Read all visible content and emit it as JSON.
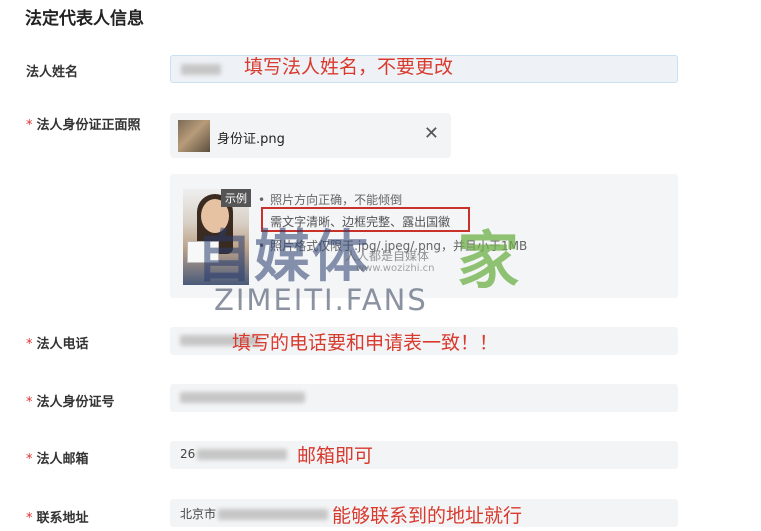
{
  "section": {
    "title": "法定代表人信息"
  },
  "fields": {
    "name": {
      "label": "法人姓名",
      "annotation": "填写法人姓名，不要更改"
    },
    "id_photo": {
      "label": "法人身份证正面照",
      "required_mark": "*",
      "file_name": "身份证.png",
      "close_icon": "close-icon"
    },
    "phone": {
      "label": "法人电话",
      "required_mark": "*",
      "annotation": "填写的电话要和申请表一致！！"
    },
    "id_number": {
      "label": "法人身份证号",
      "required_mark": "*"
    },
    "email": {
      "label": "法人邮箱",
      "required_mark": "*",
      "value_prefix": "26",
      "annotation": "邮箱即可"
    },
    "address": {
      "label": "联系地址",
      "required_mark": "*",
      "value_prefix": "北京市",
      "annotation": "能够联系到的地址就行"
    }
  },
  "example": {
    "badge": "示例",
    "rules": [
      "照片方向正确，不能倾倒",
      "需文字清晰、边框完整、露出国徽",
      "照片格式仅限于.jpg/.jpeg/.png，并且小于1MB"
    ],
    "highlight_color": "#c8322a"
  },
  "watermark": {
    "main": "自媒体",
    "jia": "家",
    "sub": "人人都是自媒体",
    "url": "www.wozizhi.cn",
    "fans": "ZIMEITI.FANS"
  },
  "colors": {
    "annotation": "#d83a2e",
    "required": "#e03030",
    "field_bg": "#f3f4f6"
  }
}
